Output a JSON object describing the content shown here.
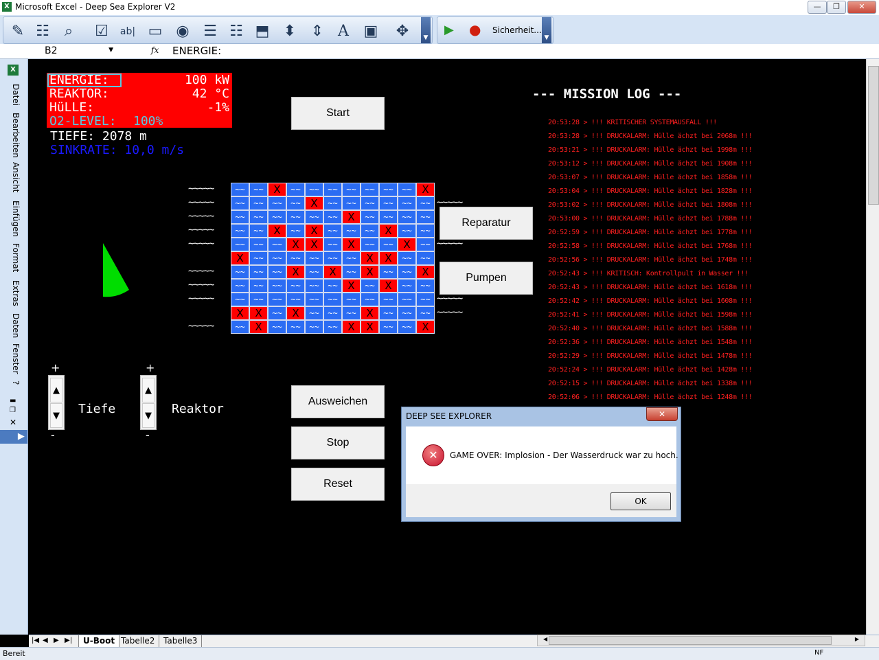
{
  "window": {
    "title": "Microsoft Excel - Deep Sea Explorer V2",
    "app_icon": "X",
    "min": "—",
    "max": "❐",
    "close": "✕"
  },
  "toolbar": {
    "macro_label": "Sicherheit...",
    "play_icon": "▶",
    "record_icon": "●"
  },
  "formula_bar": {
    "cell_ref": "B2",
    "fx": "fx",
    "content": "ENERGIE:"
  },
  "side_menu": [
    "Datei",
    "Bearbeiten",
    "Ansicht",
    "Einfügen",
    "Format",
    "Extras",
    "Daten",
    "Fenster",
    "?"
  ],
  "status": {
    "energie_label": "ENERGIE:",
    "energie_value": "100 kW",
    "reaktor_label": "REAKTOR:",
    "reaktor_value": "42 °C",
    "huelle_label": "HüLLE:",
    "huelle_value": "-1%",
    "o2_label": "O2-LEVEL:",
    "o2_value": "100%",
    "tiefe": "TIEFE: 2078 m",
    "sinkrate": "SINKRATE: 10,0 m/s"
  },
  "buttons": {
    "start": "Start",
    "reparatur": "Reparatur",
    "pumpen": "Pumpen",
    "ausweichen": "Ausweichen",
    "stop": "Stop",
    "reset": "Reset"
  },
  "controls": {
    "plus": "+",
    "minus": "-",
    "tiefe_label": "Tiefe",
    "reaktor_label": "Reaktor"
  },
  "sub_grid": {
    "wave": "~~",
    "x": "X",
    "rows": [
      [
        0,
        0,
        1,
        0,
        0,
        0,
        0,
        0,
        0,
        0,
        1
      ],
      [
        0,
        0,
        0,
        0,
        1,
        0,
        0,
        0,
        0,
        0,
        0
      ],
      [
        0,
        0,
        0,
        0,
        0,
        0,
        1,
        0,
        0,
        0,
        0
      ],
      [
        0,
        0,
        1,
        0,
        1,
        0,
        0,
        0,
        1,
        0,
        0
      ],
      [
        0,
        0,
        0,
        1,
        1,
        0,
        1,
        0,
        0,
        1,
        0
      ],
      [
        1,
        0,
        0,
        0,
        0,
        0,
        0,
        1,
        1,
        0,
        0
      ],
      [
        0,
        0,
        0,
        1,
        0,
        1,
        0,
        1,
        0,
        0,
        1
      ],
      [
        0,
        0,
        0,
        0,
        0,
        0,
        1,
        0,
        1,
        0,
        0
      ],
      [
        0,
        0,
        0,
        0,
        0,
        0,
        0,
        0,
        0,
        0,
        0
      ],
      [
        1,
        1,
        0,
        1,
        0,
        0,
        0,
        1,
        0,
        0,
        0
      ],
      [
        0,
        1,
        0,
        0,
        0,
        0,
        1,
        1,
        0,
        0,
        1
      ]
    ],
    "left_waves": [
      "~~~~~",
      "~~~~~",
      "~~~~~",
      "~~~~~",
      "~~~~~",
      "",
      "~~~~~",
      "~~~~~",
      "~~~~~",
      "",
      "~~~~~"
    ],
    "right_waves": [
      "",
      "~~~~~",
      "",
      "",
      "~~~~~",
      "",
      "",
      "",
      "~~~~~",
      "~~~~~",
      ""
    ]
  },
  "mission_log": {
    "title": "--- MISSION LOG ---",
    "entries": [
      "20:53:28 > !!! KRITISCHER SYSTEMAUSFALL !!!",
      "20:53:28 > !!! DRUCKALARM: Hülle ächzt bei 2068m !!!",
      "20:53:21 > !!! DRUCKALARM: Hülle ächzt bei 1998m !!!",
      "20:53:12 > !!! DRUCKALARM: Hülle ächzt bei 1908m !!!",
      "20:53:07 > !!! DRUCKALARM: Hülle ächzt bei 1858m !!!",
      "20:53:04 > !!! DRUCKALARM: Hülle ächzt bei 1828m !!!",
      "20:53:02 > !!! DRUCKALARM: Hülle ächzt bei 1808m !!!",
      "20:53:00 > !!! DRUCKALARM: Hülle ächzt bei 1788m !!!",
      "20:52:59 > !!! DRUCKALARM: Hülle ächzt bei 1778m !!!",
      "20:52:58 > !!! DRUCKALARM: Hülle ächzt bei 1768m !!!",
      "20:52:56 > !!! DRUCKALARM: Hülle ächzt bei 1748m !!!",
      "20:52:43 > !!! KRITISCH: Kontrollpult in Wasser !!!",
      "20:52:43 > !!! DRUCKALARM: Hülle ächzt bei 1618m !!!",
      "20:52:42 > !!! DRUCKALARM: Hülle ächzt bei 1608m !!!",
      "20:52:41 > !!! DRUCKALARM: Hülle ächzt bei 1598m !!!",
      "20:52:40 > !!! DRUCKALARM: Hülle ächzt bei 1588m !!!",
      "20:52:36 > !!! DRUCKALARM: Hülle ächzt bei 1548m !!!",
      "20:52:29 > !!! DRUCKALARM: Hülle ächzt bei 1478m !!!",
      "20:52:24 > !!! DRUCKALARM: Hülle ächzt bei 1428m !!!",
      "20:52:15 > !!! DRUCKALARM: Hülle ächzt bei 1338m !!!",
      "20:52:06 > !!! DRUCKALARM: Hülle ächzt bei 1248m !!!"
    ]
  },
  "dialog": {
    "title": "DEEP SEE EXPLORER",
    "close": "✕",
    "icon": "✕",
    "message": "GAME OVER: Implosion - Der Wasserdruck war zu hoch.",
    "ok": "OK"
  },
  "sheet_tabs": [
    "U-Boot",
    "Tabelle2",
    "Tabelle3"
  ],
  "tab_nav": [
    "|◀",
    "◀",
    "▶",
    "▶|"
  ],
  "statusbar": {
    "text": "Bereit",
    "nf": "NF"
  },
  "colors": {
    "status_bg": "#ff0000",
    "o2_text": "#58c8e0",
    "sinkrate_text": "#1a1aff",
    "grid_blue": "#2b6cf3",
    "sonar": "#00dd00",
    "log_red": "#ff2020"
  }
}
